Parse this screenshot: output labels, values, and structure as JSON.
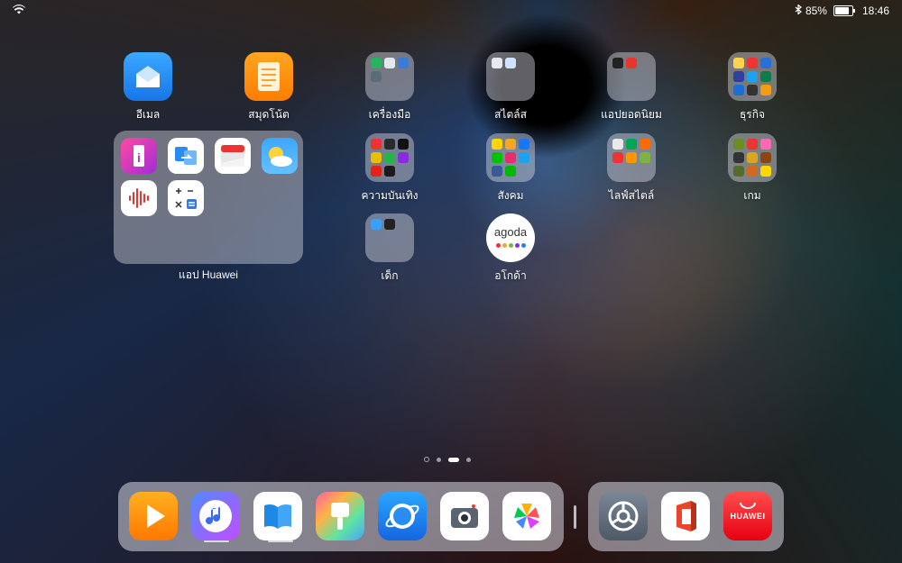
{
  "status": {
    "battery": "85%",
    "time": "18:46",
    "battery_level": 0.85
  },
  "apps": {
    "email": "อีเมล",
    "notes": "สมุดโน้ต",
    "tools": "เครื่องมือ",
    "lifestyle_top": "สไตล์ส",
    "popular": "แอปยอดนิยม",
    "business": "ธุรกิจ",
    "entertainment": "ความบันเทิง",
    "social": "สังคม",
    "lifestyle": "ไลฟ์สไตล์",
    "games": "เกม",
    "kids": "เด็ก",
    "agoda": "อโกด้า",
    "agoda_logo": "agoda"
  },
  "huawei_folder": {
    "label": "แอป Huawei"
  },
  "dock": {
    "appgallery_text": "HUAWEI"
  },
  "pages": {
    "count": 4,
    "current": 3
  }
}
